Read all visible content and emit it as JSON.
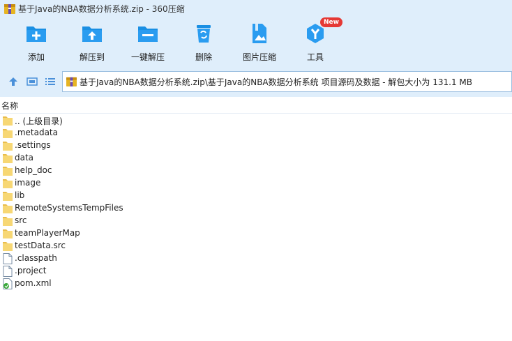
{
  "window": {
    "title": "基于Java的NBA数据分析系统.zip - 360压缩"
  },
  "toolbar": {
    "add": "添加",
    "extract_to": "解压到",
    "one_click_extract": "一键解压",
    "delete": "删除",
    "image_compress": "图片压缩",
    "tools": "工具",
    "tools_badge": "New"
  },
  "address": {
    "path": "基于Java的NBA数据分析系统.zip\\基于Java的NBA数据分析系统 项目源码及数据 - 解包大小为 131.1 MB"
  },
  "list": {
    "column_name": "名称",
    "items": [
      {
        "name": ".. (上级目录)",
        "icon": "folder-icon"
      },
      {
        "name": ".metadata",
        "icon": "folder-icon"
      },
      {
        "name": ".settings",
        "icon": "folder-icon"
      },
      {
        "name": "data",
        "icon": "folder-icon"
      },
      {
        "name": "help_doc",
        "icon": "folder-icon"
      },
      {
        "name": "image",
        "icon": "folder-icon"
      },
      {
        "name": "lib",
        "icon": "folder-icon"
      },
      {
        "name": "RemoteSystemsTempFiles",
        "icon": "folder-icon"
      },
      {
        "name": "src",
        "icon": "folder-icon"
      },
      {
        "name": "teamPlayerMap",
        "icon": "folder-icon"
      },
      {
        "name": "testData.src",
        "icon": "folder-icon"
      },
      {
        "name": ".classpath",
        "icon": "file-icon"
      },
      {
        "name": ".project",
        "icon": "file-icon"
      },
      {
        "name": "pom.xml",
        "icon": "xml-file-icon"
      }
    ]
  },
  "colors": {
    "chrome_bg": "#dfeefb",
    "icon_blue": "#1a8fe3",
    "folder_yellow": "#f7d774",
    "badge_red": "#e53935"
  }
}
